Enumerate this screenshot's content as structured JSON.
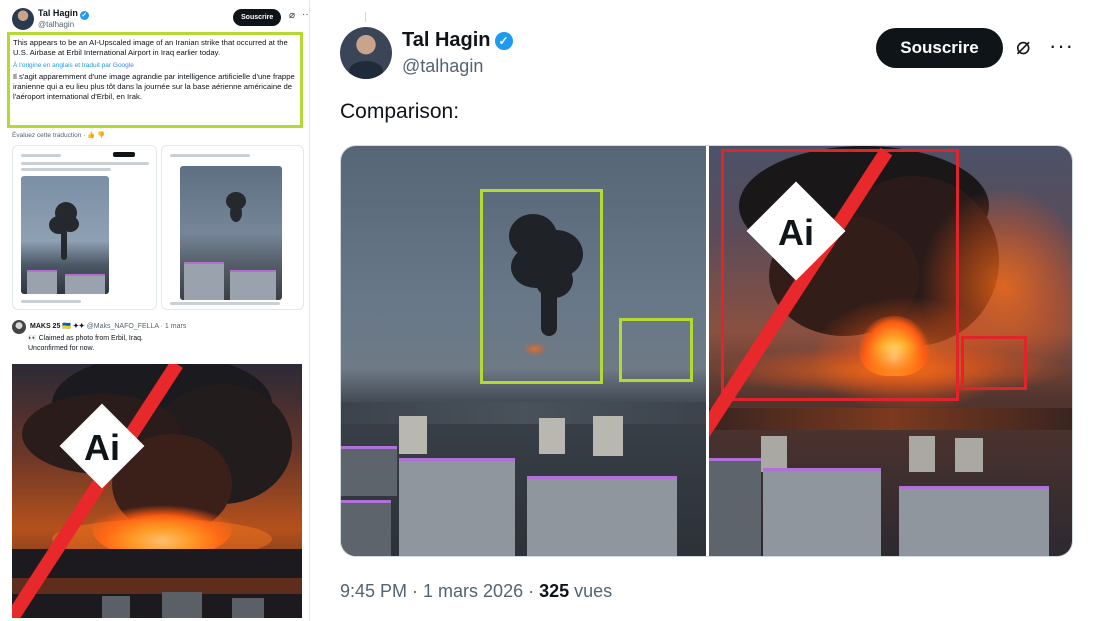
{
  "left_panel": {
    "author": {
      "name": "Tal Hagin",
      "handle": "@talhagin",
      "verified_mark": "✓"
    },
    "subscribe_label": "Souscrire",
    "grok_icon": "⌀",
    "more_icon": "···",
    "original_text": "This appears to be an AI-Upscaled image of an Iranian strike that occurred at the U.S. Airbase at Erbil International Airport in Iraq earlier today.",
    "translated_via_prefix": "À l'origine en anglais et traduit par ",
    "translated_via_brand": "Google",
    "translation_text": "Il s'agit apparemment d'une image agrandie par intelligence artificielle d'une frappe iranienne qui a eu lieu plus tôt dans la journée sur la base aérienne américaine de l'aéroport international d'Erbil, en Irak.",
    "rate_translation": "Évaluez cette traduction ·",
    "rate_icons": "👍 👎",
    "second_tweet": {
      "name": "MAKS 25 🇺🇦 ✦✦",
      "handle": "@Maks_NAFO_FELLA · 1 mars",
      "line1": "👀 Claimed as photo from Erbil, Iraq.",
      "line2": "Unconfirmed for now."
    },
    "ai_label": "Ai"
  },
  "post": {
    "author": {
      "name": "Tal Hagin",
      "handle": "@talhagin",
      "verified_mark": "✓"
    },
    "subscribe_label": "Souscrire",
    "grok_icon": "⌀",
    "more_icon": "···",
    "text": "Comparison:",
    "ai_label": "Ai",
    "timestamp": "9:45 PM · 1 mars 2026 · ",
    "views_count": "325",
    "views_label": " vues"
  }
}
